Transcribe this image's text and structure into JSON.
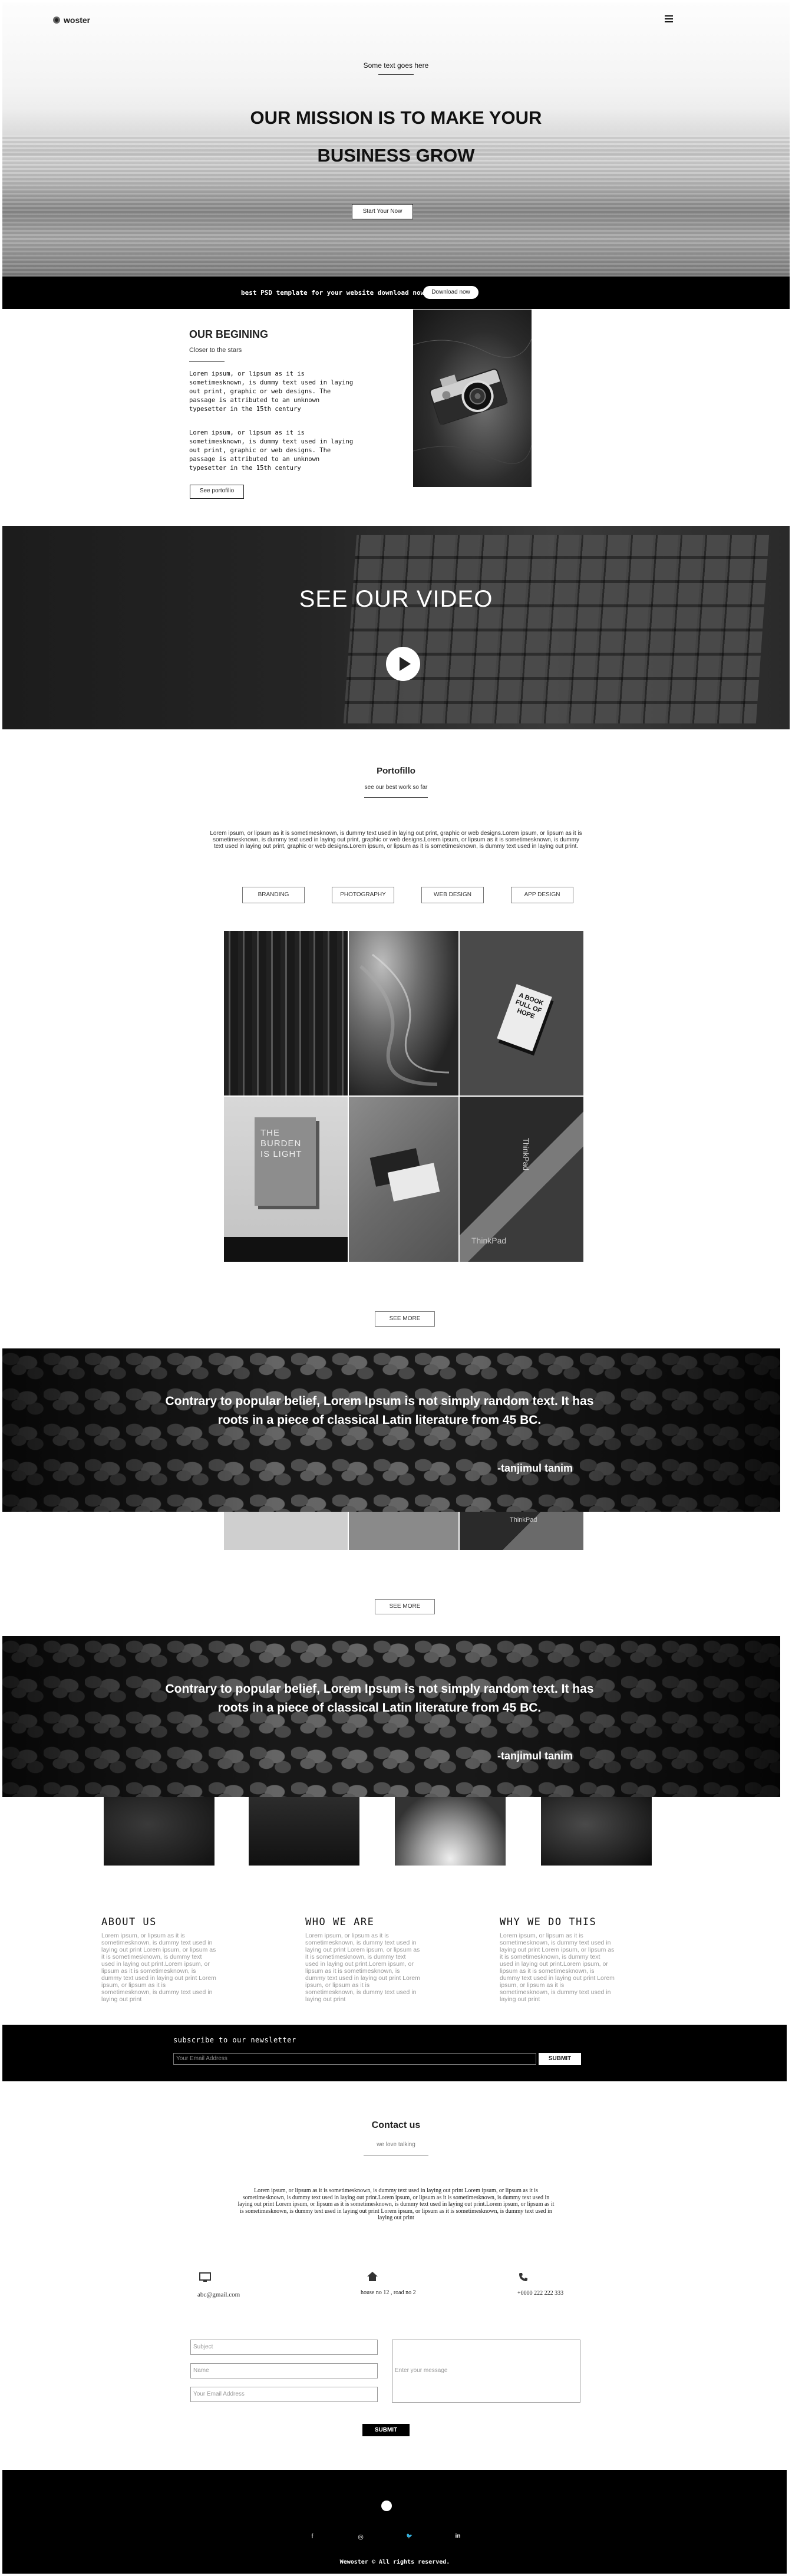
{
  "nav": {
    "brand": "woster",
    "logo_icon": "logo-dot-icon",
    "menu_icon": "hamburger-icon"
  },
  "hero": {
    "eyebrow": "Some text goes here",
    "title_line1": "OUR MISSION IS TO MAKE YOUR",
    "title_line2": "BUSINESS GROW",
    "cta": "Start Your Now"
  },
  "promo": {
    "text": "best PSD template for your website download now",
    "button": "Download now"
  },
  "beginning": {
    "title": "OUR BEGINING",
    "subtitle": "Closer to the stars",
    "para1": "Lorem ipsum, or lipsum as it is sometimesknown, is dummy text used in laying out print, graphic or web designs. The passage is attributed to an unknown typesetter in the 15th century",
    "para2": "Lorem ipsum, or lipsum as it is sometimesknown, is dummy text used in laying out print, graphic or web designs. The passage is attributed to an unknown typesetter in the 15th century",
    "button": "See portofilio"
  },
  "video": {
    "title": "SEE OUR VIDEO",
    "play_icon": "play-icon"
  },
  "portfolio": {
    "title": "Portofillo",
    "subtitle": "see our best work so far",
    "description": "Lorem ipsum, or lipsum as it is sometimesknown, is dummy text used in laying out print, graphic or web designs.Lorem ipsum, or lipsum as it is sometimesknown, is dummy text used in laying out print, graphic or web designs.Lorem ipsum, or lipsum as it is sometimesknown, is dummy text used in laying out print, graphic or web designs.Lorem ipsum, or lipsum as it is sometimesknown, is dummy text used in laying out print.",
    "filters": [
      "BRANDING",
      "PHOTOGRAPHY",
      "WEB DESIGN",
      "APP DESIGN"
    ],
    "book_text": "A BOOK FULL OF HOPE",
    "burden_text": "THE BURDEN IS LIGHT",
    "brand_text": "ThinkPad",
    "see_more": "SEE MORE",
    "see_more_2": "SEE MORE"
  },
  "quote": {
    "text": "Contrary to popular belief, Lorem Ipsum is not simply random text. It has roots in a piece of classical Latin literature from 45 BC.",
    "author": "-tanjimul tanim"
  },
  "quote2": {
    "text": "Contrary to popular belief, Lorem Ipsum is not simply random text. It has roots in a piece of classical Latin literature from 45 BC.",
    "author": "-tanjimul tanim"
  },
  "columns": [
    {
      "title": "ABOUT US",
      "text": "Lorem ipsum, or lipsum as it is sometimesknown, is dummy text used in laying out print Lorem ipsum, or lipsum as it is sometimesknown, is dummy text used in laying out print.Lorem ipsum, or lipsum as it is sometimesknown, is dummy text used in laying out print Lorem ipsum, or lipsum as it is sometimesknown, is dummy text used in laying out print"
    },
    {
      "title": "WHO WE ARE",
      "text": "Lorem ipsum, or lipsum as it is sometimesknown, is dummy text used in laying out print Lorem ipsum, or lipsum as it is sometimesknown, is dummy text used in laying out print.Lorem ipsum, or lipsum as it is sometimesknown, is dummy text used in laying out print Lorem ipsum, or lipsum as it is sometimesknown, is dummy text used in laying out print"
    },
    {
      "title": "WHY WE DO THIS",
      "text": "Lorem ipsum, or lipsum as it is sometimesknown, is dummy text used in laying out print Lorem ipsum, or lipsum as it is sometimesknown, is dummy text used in laying out print.Lorem ipsum, or lipsum as it is sometimesknown, is dummy text used in laying out print Lorem ipsum, or lipsum as it is sometimesknown, is dummy text used in laying out print"
    }
  ],
  "newsletter": {
    "title": "subscribe to our newsletter",
    "placeholder": "Your Email Address",
    "button": "SUBMIT"
  },
  "contact": {
    "title": "Contact us",
    "subtitle": "we love talking",
    "description": "Lorem ipsum, or lipsum as it is sometimesknown, is dummy text used in laying out print Lorem ipsum, or lipsum as it is sometimesknown, is dummy text used in laying out print.Lorem ipsum, or lipsum as it is sometimesknown, is dummy text used in laying out print Lorem ipsum, or lipsum as it is sometimesknown, is dummy text used in laying out print.Lorem ipsum, or lipsum as it is sometimesknown, is dummy text used in laying out print Lorem ipsum, or lipsum as it is sometimesknown, is dummy text used in laying out print",
    "email": "abc@gmail.com",
    "address": "house no 12 , road no 2",
    "phone": "+0000 222 222 333",
    "fields": {
      "subject": "Subject",
      "name": "Name",
      "email": "Your Email Address",
      "message": "Enter your message"
    },
    "submit": "SUBMIT"
  },
  "footer": {
    "socials": [
      "f",
      "◎",
      "🐦",
      "in"
    ],
    "copyright": "Wewoster © All rights reserved."
  }
}
